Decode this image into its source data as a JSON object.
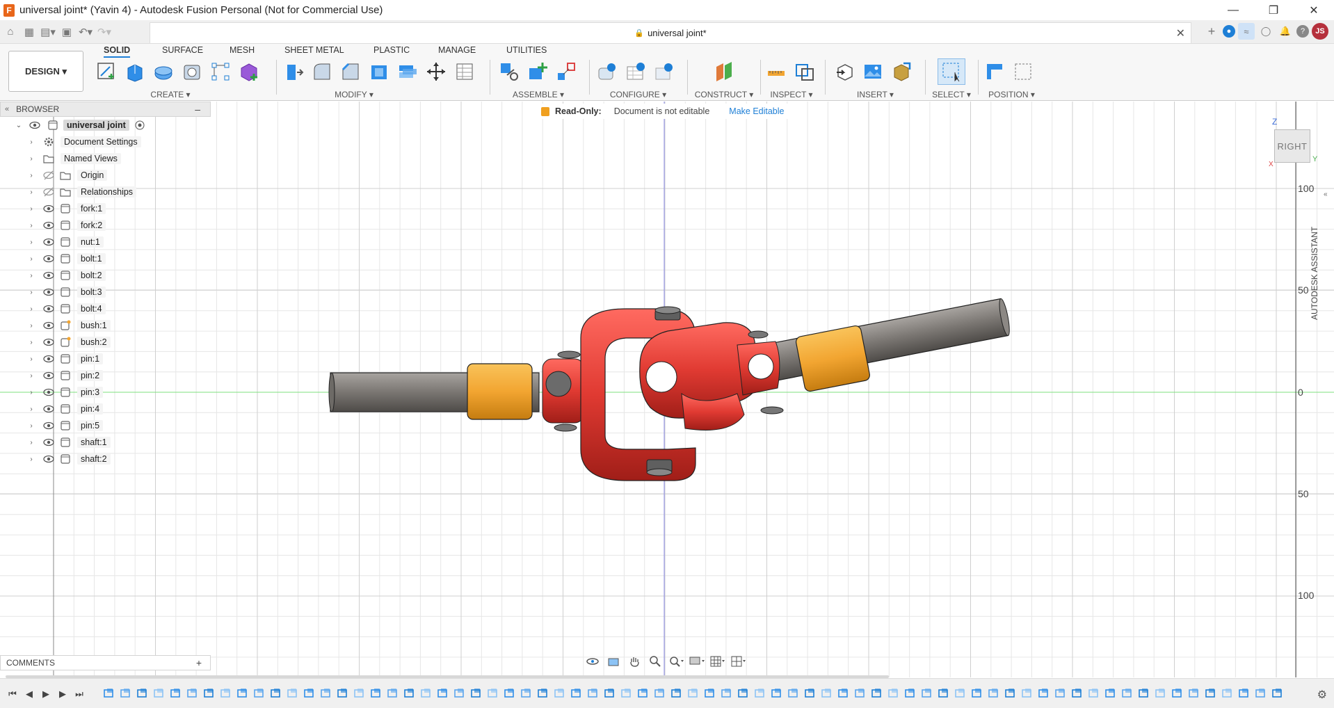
{
  "window": {
    "title": "universal joint* (Yavin 4) - Autodesk Fusion Personal (Not for Commercial Use)",
    "app_icon_letter": "F",
    "controls": [
      "minimize-icon",
      "restore-icon",
      "close-icon"
    ]
  },
  "tab": {
    "document_name": "universal joint*",
    "user_initials": "JS"
  },
  "toolbar": {
    "workspace_button": "DESIGN ▾",
    "workspace_tabs": [
      "SOLID",
      "SURFACE",
      "MESH",
      "SHEET METAL",
      "PLASTIC",
      "MANAGE",
      "UTILITIES"
    ],
    "active_tab": "SOLID",
    "groups": {
      "create": "CREATE ▾",
      "modify": "MODIFY ▾",
      "assemble": "ASSEMBLE ▾",
      "configure": "CONFIGURE ▾",
      "construct": "CONSTRUCT ▾",
      "inspect": "INSPECT ▾",
      "insert": "INSERT ▾",
      "select": "SELECT ▾",
      "position": "POSITION ▾"
    }
  },
  "browser": {
    "header": "BROWSER",
    "root": "universal joint",
    "items": [
      {
        "label": "Document Settings",
        "icon": "gear-icon"
      },
      {
        "label": "Named Views",
        "icon": "folder-icon"
      },
      {
        "label": "Origin",
        "icon": "folder-icon"
      },
      {
        "label": "Relationships",
        "icon": "folder-icon"
      },
      {
        "label": "fork:1",
        "icon": "component-icon"
      },
      {
        "label": "fork:2",
        "icon": "component-icon"
      },
      {
        "label": "nut:1",
        "icon": "component-icon"
      },
      {
        "label": "bolt:1",
        "icon": "component-icon"
      },
      {
        "label": "bolt:2",
        "icon": "component-icon"
      },
      {
        "label": "bolt:3",
        "icon": "component-icon"
      },
      {
        "label": "bolt:4",
        "icon": "component-icon"
      },
      {
        "label": "bush:1",
        "icon": "component-linked-icon"
      },
      {
        "label": "bush:2",
        "icon": "component-linked-icon"
      },
      {
        "label": "pin:1",
        "icon": "component-icon"
      },
      {
        "label": "pin:2",
        "icon": "component-icon"
      },
      {
        "label": "pin:3",
        "icon": "component-icon"
      },
      {
        "label": "pin:4",
        "icon": "component-icon"
      },
      {
        "label": "pin:5",
        "icon": "component-icon"
      },
      {
        "label": "shaft:1",
        "icon": "component-icon"
      },
      {
        "label": "shaft:2",
        "icon": "component-icon"
      }
    ]
  },
  "notice": {
    "label": "Read-Only:",
    "text": "Document is not editable",
    "action": "Make Editable"
  },
  "viewcube": {
    "face": "RIGHT",
    "axis_z": "Z",
    "axis_y": "Y",
    "axis_x": "X"
  },
  "ruler": {
    "labels": [
      "100",
      "50",
      "0",
      "50",
      "100"
    ]
  },
  "side_panel": {
    "label": "AUTODESK ASSISTANT"
  },
  "comments": {
    "label": "COMMENTS"
  },
  "colors": {
    "accent": "#1e7fd6",
    "fork_red": "#e03a32",
    "bush_orange": "#f2a531",
    "shaft_gray": "#8a8682",
    "grid_line": "#e4e4e4"
  }
}
